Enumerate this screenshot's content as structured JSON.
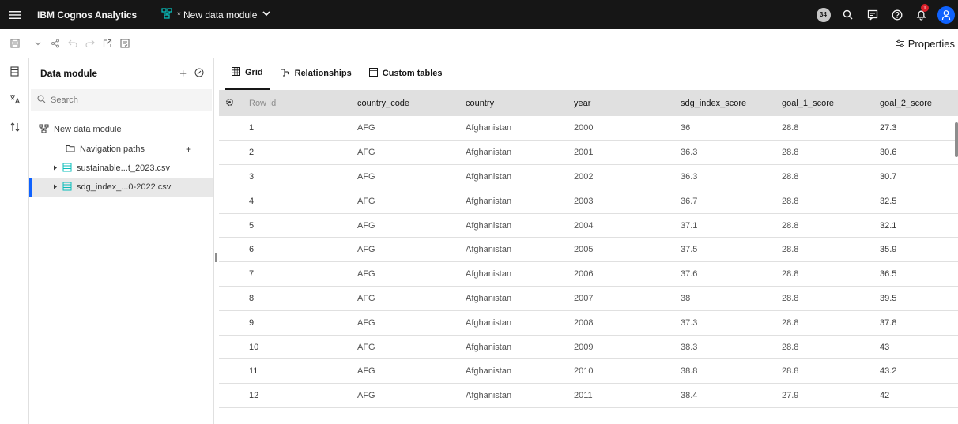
{
  "topbar": {
    "app_title": "IBM Cognos Analytics",
    "module_tab": "* New data module",
    "user_count": "34",
    "notification_count": "1"
  },
  "toolbar": {
    "properties_label": "Properties"
  },
  "panel": {
    "title": "Data module",
    "search_placeholder": "Search",
    "tree": {
      "root": "New data module",
      "navigation_paths": "Navigation paths",
      "sources": [
        "sustainable...t_2023.csv",
        "sdg_index_...0-2022.csv"
      ]
    }
  },
  "main": {
    "tabs": [
      "Grid",
      "Relationships",
      "Custom tables"
    ],
    "table": {
      "columns": [
        "Row Id",
        "country_code",
        "country",
        "year",
        "sdg_index_score",
        "goal_1_score",
        "goal_2_score"
      ],
      "rows": [
        [
          "1",
          "AFG",
          "Afghanistan",
          "2000",
          "36",
          "28.8",
          "27.3"
        ],
        [
          "2",
          "AFG",
          "Afghanistan",
          "2001",
          "36.3",
          "28.8",
          "30.6"
        ],
        [
          "3",
          "AFG",
          "Afghanistan",
          "2002",
          "36.3",
          "28.8",
          "30.7"
        ],
        [
          "4",
          "AFG",
          "Afghanistan",
          "2003",
          "36.7",
          "28.8",
          "32.5"
        ],
        [
          "5",
          "AFG",
          "Afghanistan",
          "2004",
          "37.1",
          "28.8",
          "32.1"
        ],
        [
          "6",
          "AFG",
          "Afghanistan",
          "2005",
          "37.5",
          "28.8",
          "35.9"
        ],
        [
          "7",
          "AFG",
          "Afghanistan",
          "2006",
          "37.6",
          "28.8",
          "36.5"
        ],
        [
          "8",
          "AFG",
          "Afghanistan",
          "2007",
          "38",
          "28.8",
          "39.5"
        ],
        [
          "9",
          "AFG",
          "Afghanistan",
          "2008",
          "37.3",
          "28.8",
          "37.8"
        ],
        [
          "10",
          "AFG",
          "Afghanistan",
          "2009",
          "38.3",
          "28.8",
          "43"
        ],
        [
          "11",
          "AFG",
          "Afghanistan",
          "2010",
          "38.8",
          "28.8",
          "43.2"
        ],
        [
          "12",
          "AFG",
          "Afghanistan",
          "2011",
          "38.4",
          "27.9",
          "42"
        ]
      ]
    }
  },
  "colors": {
    "topbar_bg": "#161616",
    "accent": "#0f62fe",
    "notification": "#da1e28",
    "table_header_bg": "#e0e0e0"
  }
}
